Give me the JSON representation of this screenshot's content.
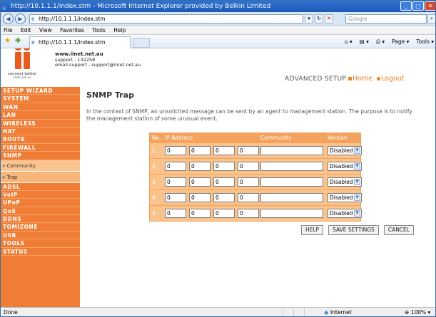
{
  "window": {
    "title": "http://10.1.1.1/index.stm - Microsoft Internet Explorer provided by Belkin Limited",
    "controls": [
      "_",
      "□",
      "✕"
    ]
  },
  "addressbar": {
    "url": "http://10.1.1.1/index.stm",
    "search_placeholder": "Google"
  },
  "menubar": [
    "File",
    "Edit",
    "View",
    "Favorites",
    "Tools",
    "Help"
  ],
  "tabbar": {
    "tab_label": "http://10.1.1.1/index.stm",
    "commands": [
      "Page ▾",
      "Tools ▾"
    ]
  },
  "header": {
    "logo_tagline": "connect better",
    "logo_sub": "iinet.net.au",
    "site": "www.iinet.net.au",
    "support": "support - 132258",
    "email": "email support - support@iinet.net.au",
    "section": "ADVANCED SETUP",
    "home_link": "Home",
    "logout_link": "Logout",
    "accent_color": "#ef7d35"
  },
  "sidebar": {
    "items_top": [
      "SETUP WIZARD",
      "SYSTEM",
      "WAN",
      "LAN",
      "WIRELESS",
      "NAT",
      "ROUTE",
      "FIREWALL",
      "SNMP"
    ],
    "sub_items": [
      "» Community",
      "» Trap"
    ],
    "items_bottom": [
      "ADSL",
      "VoIP",
      "UPnP",
      "QoS",
      "DDNS",
      "TOMIZONE",
      "USB",
      "TOOLS",
      "STATUS"
    ]
  },
  "main": {
    "title": "SNMP Trap",
    "description": "In the context of SNMP, an unsolicited message can be sent by an agent to management station. The purpose is to notify the management station of some unusual event.",
    "table": {
      "headers": [
        "No.",
        "IP Address",
        "Community",
        "Version"
      ],
      "rows": [
        {
          "no": "1",
          "ip": [
            "0",
            "0",
            "0",
            "0"
          ],
          "community": "",
          "version": "Disabled"
        },
        {
          "no": "2",
          "ip": [
            "0",
            "0",
            "0",
            "0"
          ],
          "community": "",
          "version": "Disabled"
        },
        {
          "no": "3",
          "ip": [
            "0",
            "0",
            "0",
            "0"
          ],
          "community": "",
          "version": "Disabled"
        },
        {
          "no": "4",
          "ip": [
            "0",
            "0",
            "0",
            "0"
          ],
          "community": "",
          "version": "Disabled"
        },
        {
          "no": "5",
          "ip": [
            "0",
            "0",
            "0",
            "0"
          ],
          "community": "",
          "version": "Disabled"
        }
      ]
    },
    "buttons": {
      "help": "HELP",
      "save": "SAVE SETTINGS",
      "cancel": "CANCEL"
    }
  },
  "statusbar": {
    "status": "Done",
    "zone": "Internet",
    "zoom": "100%"
  }
}
